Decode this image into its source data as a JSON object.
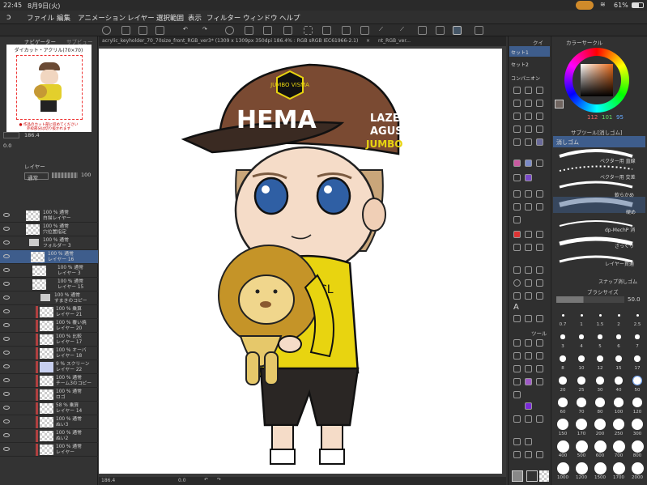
{
  "status": {
    "time": "22:45",
    "date": "8月9日(火)",
    "battery": "61%"
  },
  "menu": [
    "ファイル",
    "編集",
    "アニメーション",
    "レイヤー",
    "選択範囲",
    "表示",
    "フィルター",
    "ウィンドウ",
    "ヘルプ"
  ],
  "document": {
    "tab_title": "acrylic_keyholder_70_70size_front_RGB_ver3* (1309 x 1309px 350dpi 186.4% : RGB sRGB IEC61966-2.1)",
    "tab2": "nt_RGB_ver...",
    "zoom": "186.4",
    "rotation": "0.0"
  },
  "navigator": {
    "tab_navigator": "ナビゲーター",
    "tab_subview": "サブビュー",
    "thumb_title": "ダイカット・アクリル(70×70)",
    "thumb_note1": "● 作品のカット部に収めてください",
    "thumb_note2": "外枠部分は切り抜かれます",
    "zoom": "186.4",
    "angle": "0.0"
  },
  "layers_panel": {
    "tab": "レイヤー",
    "blend": "通常",
    "opacity": "100",
    "layers": [
      {
        "pct": "100 %",
        "mode": "通常",
        "name": "白描レイヤー"
      },
      {
        "pct": "100 %",
        "mode": "通常",
        "name": "穴位置指定"
      },
      {
        "pct": "100 %",
        "mode": "通常",
        "name": "フォルダー 3"
      },
      {
        "pct": "100 %",
        "mode": "通常",
        "name": "レイヤー 16"
      },
      {
        "pct": "100 %",
        "mode": "通常",
        "name": "レイヤー 3"
      },
      {
        "pct": "100 %",
        "mode": "通常",
        "name": "レイヤー 15"
      },
      {
        "pct": "100 %",
        "mode": "通常",
        "name": "すまきのコピー"
      },
      {
        "pct": "100 %",
        "mode": "乗算",
        "name": "レイヤー 21"
      },
      {
        "pct": "100 %",
        "mode": "覆い焼",
        "name": "レイヤー 20"
      },
      {
        "pct": "100 %",
        "mode": "比較",
        "name": "レイヤー 17"
      },
      {
        "pct": "100 %",
        "mode": "オーバ",
        "name": "レイヤー 18"
      },
      {
        "pct": "9 %",
        "mode": "スクリーン",
        "name": "レイヤー 22"
      },
      {
        "pct": "100 %",
        "mode": "通常",
        "name": "チーム3のコピー"
      },
      {
        "pct": "100 %",
        "mode": "通常",
        "name": "ロゴ"
      },
      {
        "pct": "58 %",
        "mode": "乗算",
        "name": "レイヤー 14"
      },
      {
        "pct": "100 %",
        "mode": "通常",
        "name": "ぬい3"
      },
      {
        "pct": "100 %",
        "mode": "通常",
        "name": "ぬい2"
      },
      {
        "pct": "100 %",
        "mode": "通常",
        "name": "レイヤー"
      }
    ]
  },
  "quick_panel": {
    "tab": "クイ",
    "sets": [
      "セット1",
      "セット2",
      "コンパニオン"
    ]
  },
  "color_panel": {
    "tab": "カラーサークル",
    "r": "112",
    "g": "101",
    "b": "95"
  },
  "subtool_panel": {
    "tab": "サブツール[消しゴム]",
    "selected": "消しゴム",
    "items": [
      "ベクター用 直線",
      "ベクター用 交差",
      "軟らかめ",
      "硬め",
      "dp-MechP 消",
      "ざっくり",
      "レイヤー貫通",
      "スナップ消しゴム"
    ]
  },
  "brush_size": {
    "tab": "ブラシサイズ",
    "value": "50.0",
    "sizes": [
      "0.7",
      "1",
      "1.5",
      "2",
      "2.5",
      "3",
      "4",
      "5",
      "6",
      "7",
      "8",
      "10",
      "12",
      "15",
      "17",
      "20",
      "25",
      "30",
      "40",
      "50",
      "60",
      "70",
      "80",
      "100",
      "120",
      "150",
      "170",
      "200",
      "250",
      "300",
      "400",
      "500",
      "600",
      "700",
      "800",
      "1000",
      "1200",
      "1500",
      "1700",
      "2000"
    ]
  },
  "tool_panel": {
    "tab": "ツール"
  },
  "artwork": {
    "cap_text": "HEMA",
    "cap_logo": "JUMBO VISMA",
    "cap_side1": "LAZER",
    "cap_side2": "AGUS",
    "cap_side3": "JUMBO",
    "shirt_text": "CL"
  },
  "colors": {
    "accent": "#3a6ea8",
    "cap": "#7a4a32",
    "shirt": "#e8d410",
    "hair": "#c8a878"
  }
}
